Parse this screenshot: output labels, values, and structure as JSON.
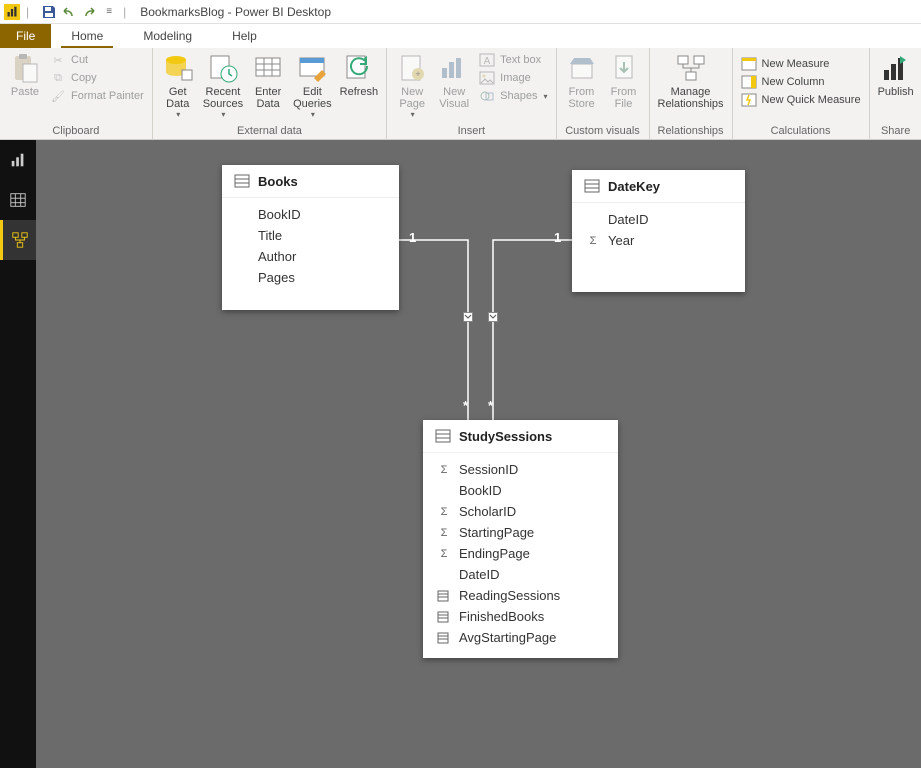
{
  "titlebar": {
    "title": "BookmarksBlog - Power BI Desktop"
  },
  "menubar": {
    "file": "File",
    "tabs": [
      "Home",
      "Modeling",
      "Help"
    ]
  },
  "ribbon": {
    "groups": {
      "clipboard": {
        "label": "Clipboard",
        "paste": "Paste",
        "cut": "Cut",
        "copy": "Copy",
        "format_painter": "Format Painter"
      },
      "external_data": {
        "label": "External data",
        "get_data": "Get\nData",
        "recent_sources": "Recent\nSources",
        "enter_data": "Enter\nData",
        "edit_queries": "Edit\nQueries",
        "refresh": "Refresh"
      },
      "insert": {
        "label": "Insert",
        "new_page": "New\nPage",
        "new_visual": "New\nVisual",
        "text_box": "Text box",
        "image": "Image",
        "shapes": "Shapes"
      },
      "custom_visuals": {
        "label": "Custom visuals",
        "from_store": "From\nStore",
        "from_file": "From\nFile"
      },
      "relationships": {
        "label": "Relationships",
        "manage": "Manage\nRelationships"
      },
      "calculations": {
        "label": "Calculations",
        "new_measure": "New Measure",
        "new_column": "New Column",
        "new_quick_measure": "New Quick Measure"
      },
      "share": {
        "label": "Share",
        "publish": "Publish"
      }
    }
  },
  "model": {
    "tables": {
      "books": {
        "name": "Books",
        "fields": [
          {
            "name": "BookID",
            "icon": ""
          },
          {
            "name": "Title",
            "icon": ""
          },
          {
            "name": "Author",
            "icon": ""
          },
          {
            "name": "Pages",
            "icon": ""
          }
        ]
      },
      "datekey": {
        "name": "DateKey",
        "fields": [
          {
            "name": "DateID",
            "icon": ""
          },
          {
            "name": "Year",
            "icon": "Σ"
          }
        ]
      },
      "studysessions": {
        "name": "StudySessions",
        "fields": [
          {
            "name": "SessionID",
            "icon": "Σ"
          },
          {
            "name": "BookID",
            "icon": ""
          },
          {
            "name": "ScholarID",
            "icon": "Σ"
          },
          {
            "name": "StartingPage",
            "icon": "Σ"
          },
          {
            "name": "EndingPage",
            "icon": "Σ"
          },
          {
            "name": "DateID",
            "icon": ""
          },
          {
            "name": "ReadingSessions",
            "icon": "calc"
          },
          {
            "name": "FinishedBooks",
            "icon": "calc"
          },
          {
            "name": "AvgStartingPage",
            "icon": "calc"
          }
        ]
      }
    },
    "relationships": {
      "left": {
        "from_card": "1",
        "to_card": "*"
      },
      "right": {
        "from_card": "1",
        "to_card": "*"
      }
    }
  }
}
